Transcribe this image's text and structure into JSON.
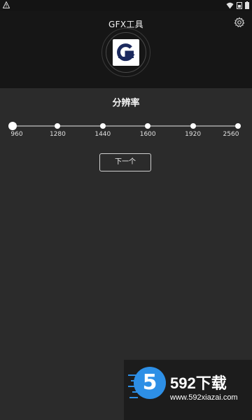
{
  "app": {
    "title": "GFX工具"
  },
  "status_bar": {
    "icons": [
      "warning-icon",
      "wifi-icon",
      "sim-icon",
      "battery-icon"
    ]
  },
  "icons": {
    "settings": "gear-icon",
    "logo": "gfx-logo-icon"
  },
  "resolution": {
    "title": "分辨率",
    "options": [
      "960",
      "1280",
      "1440",
      "1600",
      "1920",
      "2560"
    ],
    "selected": "960"
  },
  "actions": {
    "next_label": "下一个"
  },
  "watermark": {
    "logo_digit": "5",
    "brand": "592下载",
    "url": "www.592xiazai.com"
  },
  "colors": {
    "header_bg": "#161616",
    "body_bg": "#2b2b2b",
    "accent": "#ffffff",
    "watermark_blue": "#2d8fe6"
  }
}
